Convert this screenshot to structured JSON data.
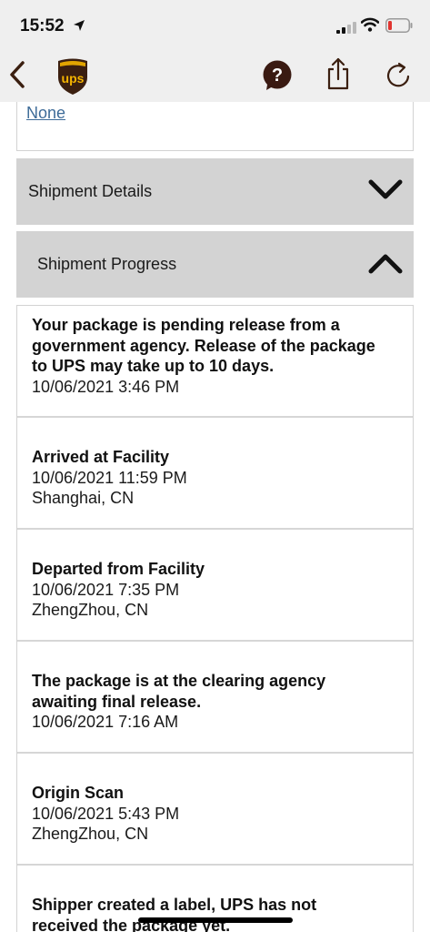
{
  "status_bar": {
    "time": "15:52"
  },
  "nav": {
    "back_icon": "chevron-left-icon",
    "logo_icon": "ups-shield-logo",
    "logo_text": "ups",
    "help_icon": "question-bubble-icon",
    "share_icon": "share-icon",
    "refresh_icon": "refresh-icon"
  },
  "top_card": {
    "link": "None"
  },
  "sections": {
    "details": {
      "label": "Shipment Details",
      "state": "collapsed"
    },
    "progress": {
      "label": "Shipment Progress",
      "state": "expanded"
    }
  },
  "progress_items": [
    {
      "status_lines": [
        "Your package is pending release from a",
        "government agency. Release of the package",
        "to UPS may take up to 10 days."
      ],
      "datetime": "10/06/2021   3:46 PM",
      "location": ""
    },
    {
      "status_lines": [
        "Arrived at Facility"
      ],
      "datetime": "10/06/2021   11:59 PM",
      "location": "Shanghai, CN"
    },
    {
      "status_lines": [
        "Departed from Facility"
      ],
      "datetime": "10/06/2021   7:35 PM",
      "location": "ZhengZhou, CN"
    },
    {
      "status_lines": [
        "The package is at the clearing agency",
        "awaiting final release."
      ],
      "datetime": "10/06/2021   7:16 AM",
      "location": ""
    },
    {
      "status_lines": [
        "Origin Scan"
      ],
      "datetime": "10/06/2021   5:43 PM",
      "location": "ZhengZhou, CN"
    },
    {
      "status_lines": [
        "Shipper created a label, UPS has not",
        "received the package yet."
      ],
      "datetime": "",
      "location": ""
    }
  ],
  "colors": {
    "ups_brown": "#3b1f10",
    "ups_gold": "#f5b400",
    "help_bubble": "#3a1a12",
    "header_bg": "#d3d3d3",
    "link": "#3d6b98",
    "battery_low": "#e0342f"
  }
}
